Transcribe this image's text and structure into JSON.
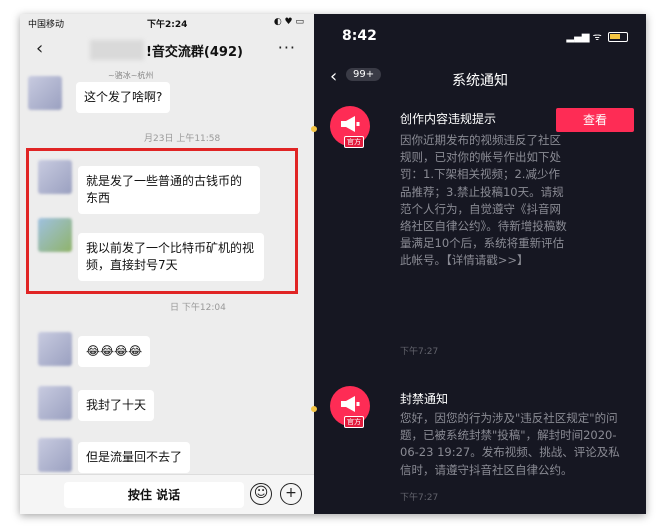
{
  "left": {
    "status": {
      "carrier": "中国移动",
      "time": "下午2:24",
      "icons": "◐ ♥ ▭"
    },
    "nav": {
      "back": "‹",
      "title": "!音交流群(492)",
      "title_suffix_icon": "mute-icon",
      "more": "···"
    },
    "messages": [
      {
        "nick": "~骆冰~杭州",
        "text": "这个发了啥啊?"
      },
      {
        "nick": "",
        "text": "就是发了一些普通的古钱币的东西"
      },
      {
        "nick": "",
        "text": "我以前发了一个比特币矿机的视频，直接封号7天"
      },
      {
        "nick": "",
        "text": "😂😂😂😂"
      },
      {
        "nick": "",
        "text": "我封了十天"
      },
      {
        "nick": "",
        "text": "但是流量回不去了"
      }
    ],
    "timestamps": [
      "月23日 上午11:58",
      "日 下午12:04"
    ],
    "input": {
      "hold_to_talk": "按住 说话",
      "emoji": "☺",
      "plus": "+"
    }
  },
  "right": {
    "status": {
      "time": "8:42",
      "icons": "▂▄▆ ᯤ"
    },
    "nav": {
      "back": "‹",
      "badge": "99+",
      "title": "系统通知"
    },
    "notifications": [
      {
        "title": "创作内容违规提示",
        "tag": "官方",
        "button": "查看",
        "body": "因你近期发布的视频违反了社区规则，已对你的帐号作出如下处罚：1.下架相关视频；2.减少作品推荐；3.禁止投稿10天。请规范个人行为，自觉遵守《抖音网络社区自律公约》。待新增投稿数量满足10个后，系统将重新评估此帐号。【详情请戳>>】",
        "time": "下午7:27"
      },
      {
        "title": "封禁通知",
        "tag": "官方",
        "body": "您好，因您的行为涉及\"违反社区规定\"的问题，已被系统封禁\"投稿\"，解封时间2020-06-23 19:27。发布视频、挑战、评论及私信时，请遵守抖音社区自律公约。",
        "time": "下午7:27"
      }
    ]
  },
  "colors": {
    "accent": "#fe2c55",
    "dot": "#f5c542",
    "highlight_box": "#e02424"
  }
}
